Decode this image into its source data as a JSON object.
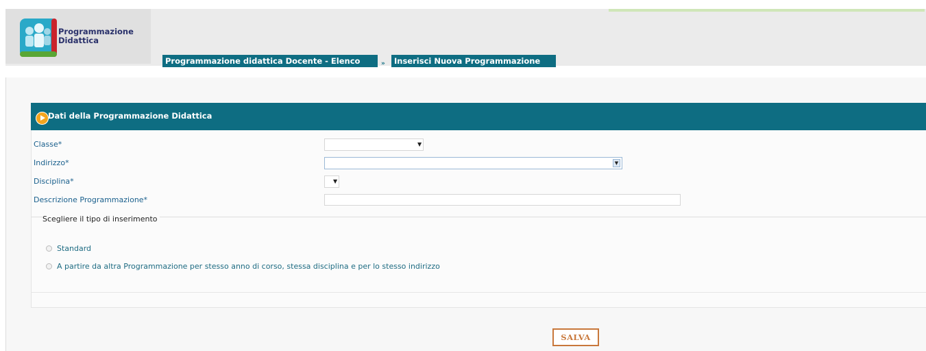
{
  "app": {
    "logo_line1": "Programmazione",
    "logo_line2": "Didattica"
  },
  "breadcrumb": {
    "items": [
      {
        "label": "Programmazione didattica Docente - Elenco"
      },
      {
        "label": "Inserisci Nuova Programmazione"
      }
    ],
    "separator": "»"
  },
  "section": {
    "title": "Dati della Programmazione Didattica"
  },
  "form": {
    "classe_label": "Classe*",
    "classe_value": "",
    "indirizzo_label": "Indirizzo*",
    "indirizzo_value": "",
    "disciplina_label": "Disciplina*",
    "disciplina_value": "",
    "descrizione_label": "Descrizione Programmazione*",
    "descrizione_value": ""
  },
  "insert_type": {
    "legend": "Scegliere il tipo di inserimento",
    "options": [
      {
        "label": "Standard",
        "selected": false
      },
      {
        "label": "A partire da altra Programmazione per stesso anno di corso, stessa disciplina e per lo stesso indirizzo",
        "selected": false
      }
    ]
  },
  "actions": {
    "save_label": "SALVA"
  },
  "colors": {
    "header_teal": "#0e6d82",
    "label_blue": "#195f8c",
    "accent_orange": "#f5a51e",
    "save_border": "#c8773a"
  },
  "icons": {
    "logo": "people-group-icon",
    "section": "play-circle-icon",
    "dropdown": "chevron-down-icon"
  }
}
